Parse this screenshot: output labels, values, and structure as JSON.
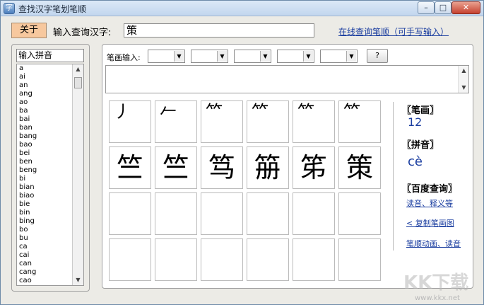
{
  "window": {
    "title": "查找汉字笔划笔顺",
    "min_label": "–",
    "max_label": "□",
    "close_label": "✕"
  },
  "toolbar": {
    "about_label": "关于",
    "query_label": "输入查询汉字:",
    "query_value": "策",
    "online_link": "在线查询笔顺（可手写输入）"
  },
  "pinyin": {
    "input_value": "输入拼音",
    "items": [
      "a",
      "ai",
      "an",
      "ang",
      "ao",
      "ba",
      "bai",
      "ban",
      "bang",
      "bao",
      "bei",
      "ben",
      "beng",
      "bi",
      "bian",
      "biao",
      "bie",
      "bin",
      "bing",
      "bo",
      "bu",
      "ca",
      "cai",
      "can",
      "cang",
      "cao"
    ]
  },
  "stroke_input": {
    "label": "笔画输入:",
    "help_label": "?"
  },
  "stroke_order": {
    "frames": [
      "丿",
      "𠂉",
      "⺮",
      "⺮",
      "⺮",
      "⺮",
      "竺",
      "竺",
      "笃",
      "笧",
      "笫",
      "策"
    ],
    "empty_cells": 12
  },
  "info": {
    "stroke_heading": "〖笔画〗",
    "stroke_count": "12",
    "pinyin_heading": "〖拼音〗",
    "pinyin_value": "cè",
    "baidu_heading": "〖百度查询〗",
    "link_reading": "读音、释义等",
    "link_copy": "< 复制笔画图",
    "link_animation": "笔顺动画、读音"
  },
  "watermark": {
    "text": "KK下载",
    "url": "www.kkx.net"
  }
}
